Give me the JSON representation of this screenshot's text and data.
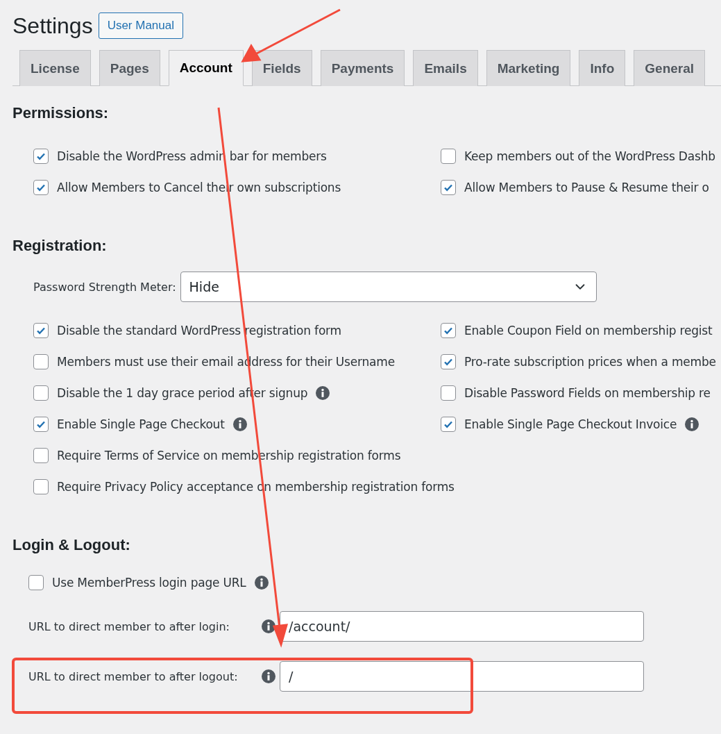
{
  "header": {
    "title": "Settings",
    "manual_button": "User Manual"
  },
  "tabs": [
    {
      "label": "License",
      "selected": false
    },
    {
      "label": "Pages",
      "selected": false
    },
    {
      "label": "Account",
      "selected": true
    },
    {
      "label": "Fields",
      "selected": false
    },
    {
      "label": "Payments",
      "selected": false
    },
    {
      "label": "Emails",
      "selected": false
    },
    {
      "label": "Marketing",
      "selected": false
    },
    {
      "label": "Info",
      "selected": false
    },
    {
      "label": "General",
      "selected": false
    }
  ],
  "permissions": {
    "heading": "Permissions:",
    "rows": [
      [
        {
          "label": "Disable the WordPress admin bar for members",
          "checked": true
        },
        {
          "label": "Keep members out of the WordPress Dashb",
          "checked": false
        }
      ],
      [
        {
          "label": "Allow Members to Cancel their own subscriptions",
          "checked": true
        },
        {
          "label": "Allow Members to Pause & Resume their o",
          "checked": true
        }
      ]
    ]
  },
  "registration": {
    "heading": "Registration:",
    "password_meter": {
      "label": "Password Strength Meter:",
      "value": "Hide"
    },
    "rows": [
      [
        {
          "label": "Disable the standard WordPress registration form",
          "checked": true
        },
        {
          "label": "Enable Coupon Field on membership regist",
          "checked": true
        }
      ],
      [
        {
          "label": "Members must use their email address for their Username",
          "checked": false
        },
        {
          "label": "Pro-rate subscription prices when a membe",
          "checked": true
        }
      ],
      [
        {
          "label": "Disable the 1 day grace period after signup",
          "checked": false,
          "info": true
        },
        {
          "label": "Disable Password Fields on membership re",
          "checked": false
        }
      ],
      [
        {
          "label": "Enable Single Page Checkout",
          "checked": true,
          "info": true
        },
        {
          "label": "Enable Single Page Checkout Invoice",
          "checked": true,
          "info": true
        }
      ],
      [
        {
          "label": "Require Terms of Service on membership registration forms",
          "checked": false
        }
      ],
      [
        {
          "label": "Require Privacy Policy acceptance on membership registration forms",
          "checked": false
        }
      ]
    ]
  },
  "login": {
    "heading": "Login & Logout:",
    "options": [
      {
        "label": "Use MemberPress login page URL",
        "checked": false,
        "info": true
      }
    ],
    "url_fields": [
      {
        "label": "URL to direct member to after login:",
        "value": "/account/",
        "info": true
      },
      {
        "label": "URL to direct member to after logout:",
        "value": "/",
        "info": true
      }
    ]
  }
}
